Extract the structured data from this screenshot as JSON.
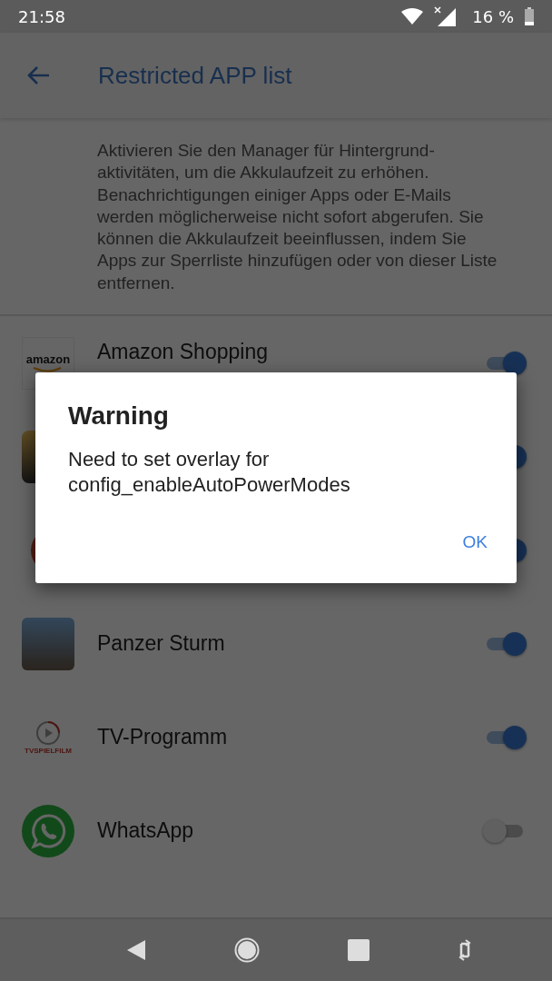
{
  "status_bar": {
    "time": "21:58",
    "battery": "16 %"
  },
  "app_bar": {
    "title": "Restricted APP list"
  },
  "description": "Aktivieren Sie den Manager für Hintergrund-aktivitäten, um die Akkulaufzeit zu erhöhen. Benachrichtigungen einiger Apps oder E-Mails werden möglicherweise nicht sofort abgerufen. Sie können die Akkulaufzeit beeinflussen, indem Sie Apps zur Sperrliste hinzufügen oder von dieser Liste entfernen.",
  "apps": [
    {
      "kind": "amazon",
      "name": "Amazon Shopping",
      "icon_text": "amazon",
      "on": true
    },
    {
      "kind": "game",
      "on": true
    },
    {
      "kind": "red",
      "on": true
    },
    {
      "kind": "photo",
      "name": "Panzer Sturm",
      "on": true
    },
    {
      "kind": "tv",
      "name": "TV-Programm",
      "icon_text": "TVSPIELFILM",
      "on": true
    },
    {
      "kind": "whatsapp",
      "name": "WhatsApp",
      "on": false
    }
  ],
  "dialog": {
    "title": "Warning",
    "message": "Need to set overlay for config_enableAutoPowerModes",
    "button": "OK"
  }
}
